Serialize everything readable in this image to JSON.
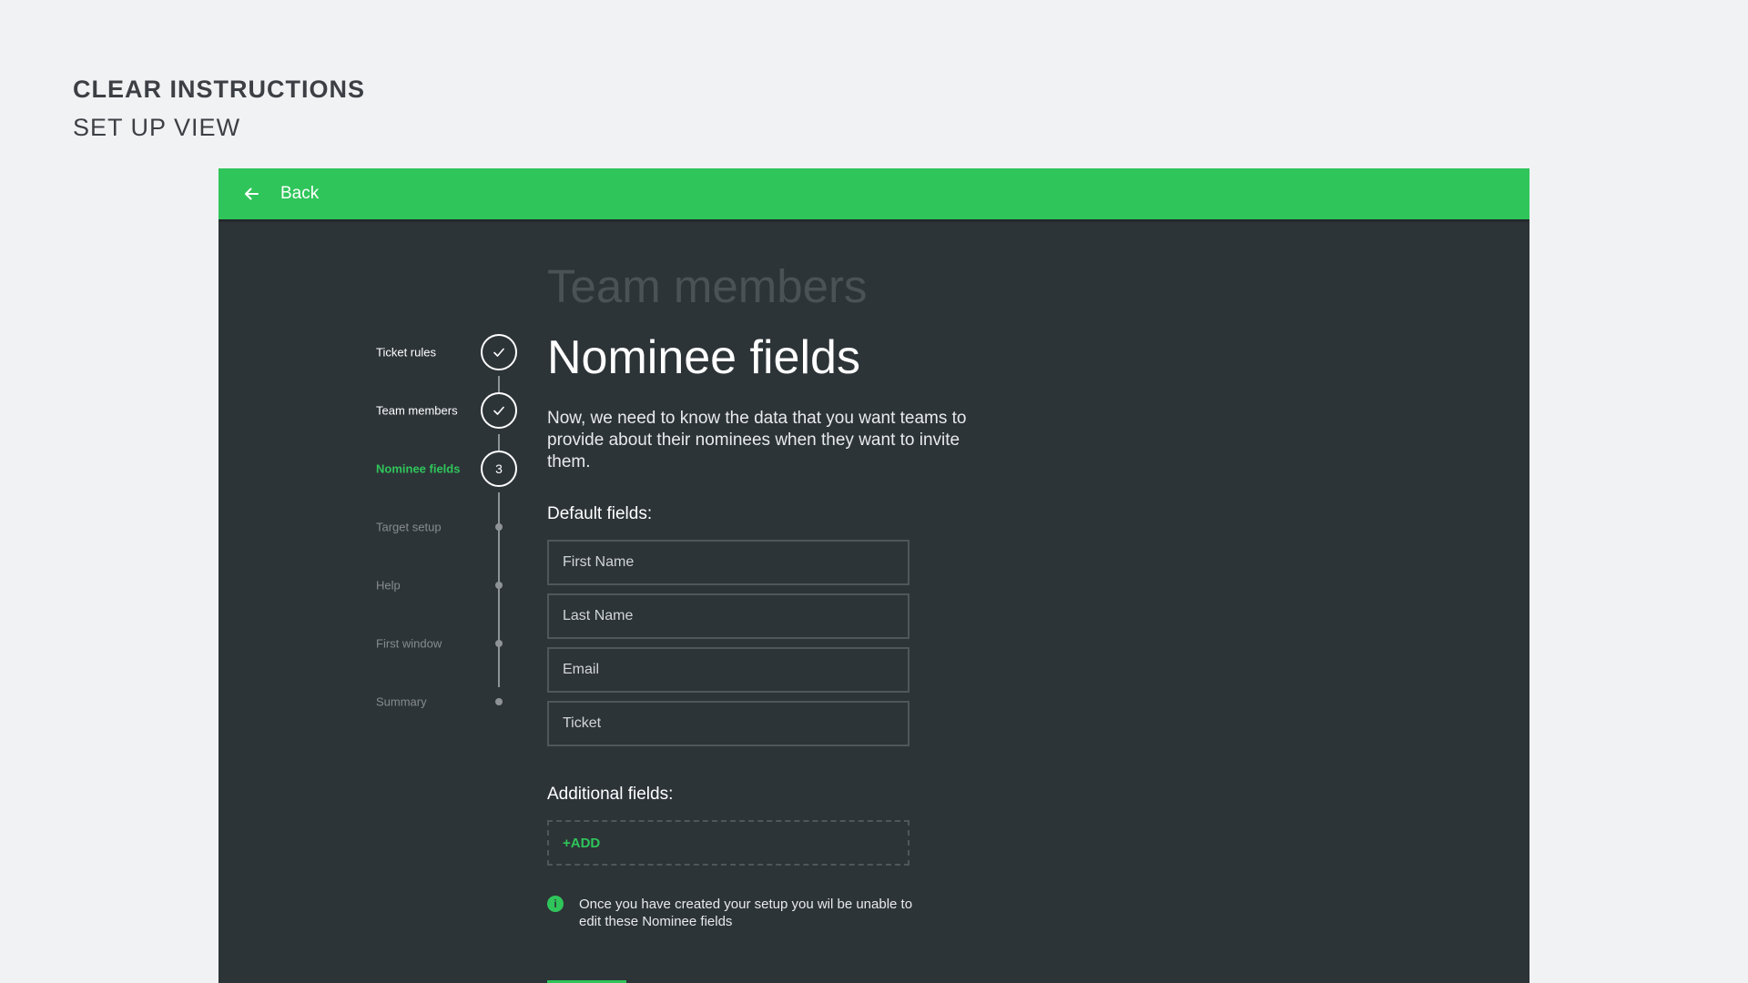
{
  "page": {
    "heading": "CLEAR INSTRUCTIONS",
    "subheading": "SET UP VIEW"
  },
  "topbar": {
    "back_icon": "arrow-left-icon",
    "back_label": "Back"
  },
  "stepper": {
    "steps": [
      {
        "label": "Ticket rules",
        "state": "done",
        "icon": "check-icon"
      },
      {
        "label": "Team members",
        "state": "done",
        "icon": "check-icon"
      },
      {
        "label": "Nominee fields",
        "state": "active",
        "number": "3"
      },
      {
        "label": "Target setup",
        "state": "future"
      },
      {
        "label": "Help",
        "state": "future"
      },
      {
        "label": "First window",
        "state": "future"
      },
      {
        "label": "Summary",
        "state": "future"
      }
    ]
  },
  "main": {
    "previous_title": "Team members",
    "title": "Nominee fields",
    "description": "Now, we need to know the data that you want teams to provide about their nominees when they want to invite them.",
    "default_fields_label": "Default fields:",
    "default_fields": [
      "First Name",
      "Last Name",
      "Email",
      "Ticket"
    ],
    "additional_fields_label": "Additional fields:",
    "add_label": "+ADD",
    "info_icon": "info-icon",
    "info_icon_glyph": "i",
    "info_text": "Once you have created your setup you wil be unable to edit these Nominee fields"
  },
  "colors": {
    "accent": "#2fc55a",
    "panel_background": "#2d3438",
    "page_background": "#f1f2f4"
  }
}
